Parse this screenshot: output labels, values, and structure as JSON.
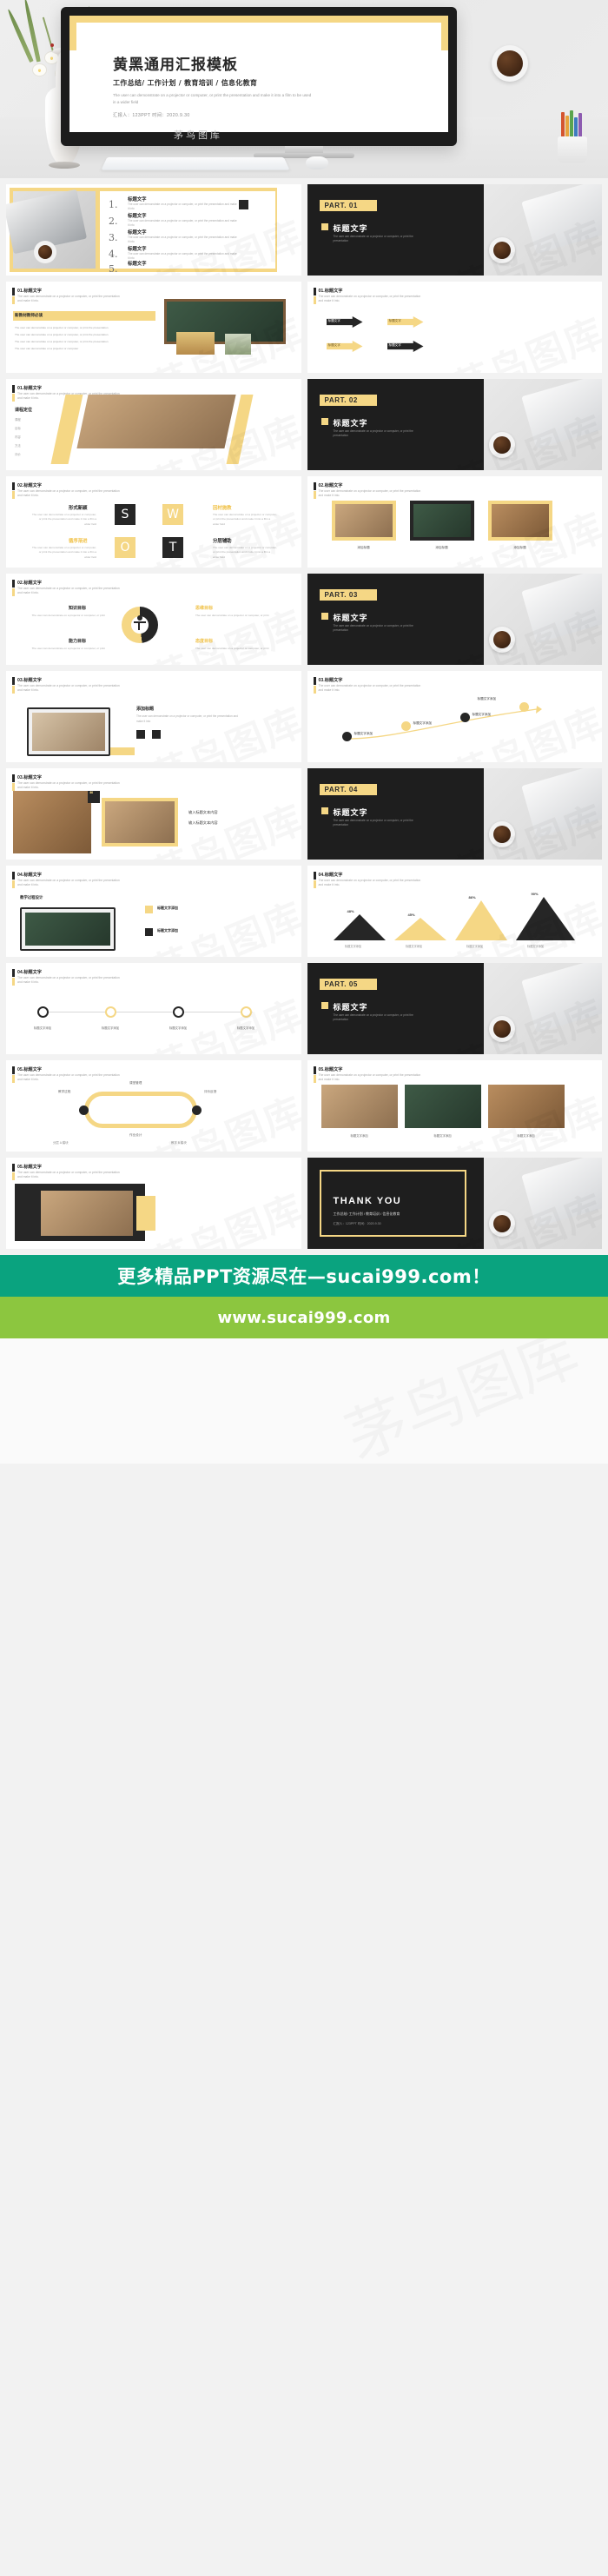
{
  "hero": {
    "title": "黄黑通用汇报模板",
    "subtitle": "工作总结/ 工作计划 / 教育培训 / 信息化教育",
    "description": "The user can demonstrate on a projector or computer, or print the presentation and make it into a film to be used in a wider field",
    "meta": "汇报人：123PPT   时间：2020.9.30",
    "watermark": "茅鸟图库"
  },
  "colors": {
    "yellow": "#f5d785",
    "dark": "#262626",
    "footer_green": "#0aa37f",
    "footer_light_green": "#8cc63f"
  },
  "common": {
    "heading": "标题文字",
    "lorem_short": "The user can demonstrate on a projector or computer, or print the presentation and make it into",
    "lorem_long": "The user can demonstrate on a projector or computer, or print the presentation and make it into a film a wider field",
    "part_desc": "The user can demonstrate on a projector or computer, or print the presentation and make it into",
    "watermark": "茅鸟图库"
  },
  "slides": [
    {
      "id": 1,
      "type": "numbered-list",
      "items": [
        {
          "num": "1.",
          "title": "标题文字",
          "desc": "The user can demonstrate on a projector or computer, or print the presentation and make it into"
        },
        {
          "num": "2.",
          "title": "标题文字",
          "desc": "The user can demonstrate on a projector or computer, or print the presentation and make it into"
        },
        {
          "num": "3.",
          "title": "标题文字",
          "desc": "The user can demonstrate on a projector or computer, or print the presentation and make it into"
        },
        {
          "num": "4.",
          "title": "标题文字",
          "desc": "The user can demonstrate on a projector or computer, or print the presentation and make it into"
        },
        {
          "num": "5.",
          "title": "标题文字",
          "desc": "The user can demonstrate on a projector or computer, or print the presentation and make it into"
        }
      ]
    },
    {
      "id": 2,
      "type": "part-divider",
      "part_label": "PART. 01",
      "title": "标题文字",
      "desc": "The user can demonstrate on a projector or computer, or print the presentation"
    },
    {
      "id": 3,
      "type": "classroom",
      "head": "01.标题文字",
      "head_sub": "The user can demonstrate on a projector or computer, or print the presentation and make it into.",
      "panel_title": "新教材教师必读",
      "bullets": [
        "The user can demonstrate on a projector or computer, or print the presentation",
        "The user can demonstrate on a projector or computer, or print the presentation",
        "The user can demonstrate on a projector or computer, or print the presentation",
        "The user can demonstrate on a projector or computer"
      ]
    },
    {
      "id": 4,
      "type": "arrows",
      "head": "01.标题文字",
      "head_sub": "The user can demonstrate on a projector or computer, or print the presentation and make it into.",
      "arrows": [
        "标题文字",
        "标题文字",
        "标题文字",
        "标题文字"
      ]
    },
    {
      "id": 5,
      "type": "positioning",
      "head": "01.标题文字",
      "head_sub": "The user can demonstrate on a projector or computer, or print the presentation and make it into.",
      "panel_title": "课程定位",
      "rows": [
        "课程",
        "目标",
        "内容",
        "方法",
        "评价"
      ]
    },
    {
      "id": 6,
      "type": "part-divider",
      "part_label": "PART. 02",
      "title": "标题文字",
      "desc": "The user can demonstrate on a projector or computer, or print the presentation"
    },
    {
      "id": 7,
      "type": "swot",
      "head": "02.标题文字",
      "head_sub": "The user can demonstrate on a projector or computer, or print the presentation and make it into.",
      "cells": [
        {
          "letter": "S",
          "style": "dark",
          "label": "形式新颖",
          "label_color": "#262626",
          "desc": "The user can demonstrate on a projector or computer, or print the presentation and make it into a film a wider field"
        },
        {
          "letter": "W",
          "style": "yellow",
          "label": "因材施教",
          "label_color": "#f0c24a",
          "desc": "The user can demonstrate on a projector or computer, or print the presentation and make it into a film a wider field"
        },
        {
          "letter": "O",
          "style": "yellow",
          "label": "循序渐进",
          "label_color": "#f0c24a",
          "desc": "The user can demonstrate on a projector or computer, or print the presentation and make it into a film a wider field"
        },
        {
          "letter": "T",
          "style": "dark",
          "label": "分层辅助",
          "label_color": "#262626",
          "desc": "The user can demonstrate on a projector or computer, or print the presentation and make it into a film a wider field"
        }
      ]
    },
    {
      "id": 8,
      "type": "photo-trio",
      "head": "02.标题文字",
      "head_sub": "The user can demonstrate on a projector or computer, or print the presentation and make it into.",
      "captions": [
        "添加标题",
        "添加标题",
        "添加标题"
      ]
    },
    {
      "id": 9,
      "type": "goals-donut",
      "head": "02.标题文字",
      "head_sub": "The user can demonstrate on a projector or computer, or print the presentation and make it into.",
      "goals": [
        {
          "label": "知识目标",
          "desc": "The user can demonstrate on a projector or computer, or print"
        },
        {
          "label": "思维目标",
          "desc": "The user can demonstrate on a projector or computer, or print"
        },
        {
          "label": "能力目标",
          "desc": "The user can demonstrate on a projector or computer, or print"
        },
        {
          "label": "态度目标",
          "desc": "The user can demonstrate on a projector or computer, or print"
        }
      ]
    },
    {
      "id": 10,
      "type": "part-divider",
      "part_label": "PART. 03",
      "title": "标题文字",
      "desc": "The user can demonstrate on a projector or computer, or print the presentation"
    },
    {
      "id": 11,
      "type": "laptop-list",
      "head": "03.标题文字",
      "head_sub": "The user can demonstrate on a projector or computer, or print the presentation and make it into.",
      "panel_title": "添加标题",
      "desc": "The user can demonstrate on a projector or computer, or print the presentation and make it into"
    },
    {
      "id": 12,
      "type": "step-circles",
      "head": "03.标题文字",
      "head_sub": "The user can demonstrate on a projector or computer, or print the presentation and make it into.",
      "steps": [
        "标题文字添加",
        "标题文字添加",
        "标题文字添加",
        "标题文字添加"
      ]
    },
    {
      "id": 13,
      "type": "quote-photos",
      "head": "03.标题文字",
      "head_sub": "The user can demonstrate on a projector or computer, or print the presentation and make it into.",
      "quote_mark": "❝",
      "lines": [
        "输入标题文本内容",
        "输入标题文本内容"
      ]
    },
    {
      "id": 14,
      "type": "part-divider",
      "part_label": "PART. 04",
      "title": "标题文字",
      "desc": "The user can demonstrate on a projector or computer, or print the presentation"
    },
    {
      "id": 15,
      "type": "laptop-photo",
      "head": "04.标题文字",
      "head_sub": "The user can demonstrate on a projector or computer, or print the presentation and make it into.",
      "panel_title": "教学过程设计",
      "captions": [
        "标题文字添加",
        "标题文字添加"
      ]
    },
    {
      "id": 16,
      "type": "mountain-chart",
      "head": "04.标题文字",
      "head_sub": "The user can demonstrate on a projector or computer, or print the presentation and make it into.",
      "chart": {
        "type": "area",
        "categories": [
          "标题文字添加",
          "标题文字添加",
          "标题文字添加",
          "标题文字添加"
        ],
        "values": [
          48,
          45,
          86,
          90
        ],
        "labels": [
          "48%",
          "45%",
          "86%",
          "90%"
        ],
        "colors": [
          "#262626",
          "#f5d785",
          "#f5d785",
          "#262626"
        ],
        "ylim": [
          0,
          100
        ],
        "grid": false,
        "title": "",
        "legend": "bottom"
      }
    },
    {
      "id": 17,
      "type": "timeline",
      "head": "04.标题文字",
      "head_sub": "The user can demonstrate on a projector or computer, or print the presentation and make it into.",
      "points": [
        "标题文字添加",
        "标题文字添加",
        "标题文字添加",
        "标题文字添加"
      ]
    },
    {
      "id": 18,
      "type": "part-divider",
      "part_label": "PART. 05",
      "title": "标题文字",
      "desc": "The user can demonstrate on a projector or computer, or print the presentation"
    },
    {
      "id": 19,
      "type": "loop-cycle",
      "head": "05.标题文字",
      "head_sub": "The user can demonstrate on a projector or computer, or print the presentation and make it into.",
      "labels": [
        "教学过程",
        "课堂管理",
        "评价反馈",
        "作业设计"
      ],
      "bottom": [
        "分层 A 模块",
        "教学 B 模块"
      ]
    },
    {
      "id": 20,
      "type": "photo-trio-2",
      "head": "05.标题文字",
      "head_sub": "The user can demonstrate on a projector or computer, or print the presentation and make it into.",
      "captions": [
        "标题文字添加",
        "标题文字添加",
        "标题文字添加"
      ]
    },
    {
      "id": 21,
      "type": "dark-photo",
      "head": "05.标题文字",
      "head_sub": "The user can demonstrate on a projector or computer, or print the presentation and make it into."
    },
    {
      "id": 22,
      "type": "thanks",
      "title": "THANK YOU",
      "subtitle": "工作总结/ 工作计划 / 教育培训 / 信息化教育",
      "meta": "汇报人：123PPT   时间：2020.9.30"
    }
  ],
  "footer": {
    "line1": "更多精品PPT资源尽在—sucai999.com！",
    "line2": "www.sucai999.com"
  }
}
